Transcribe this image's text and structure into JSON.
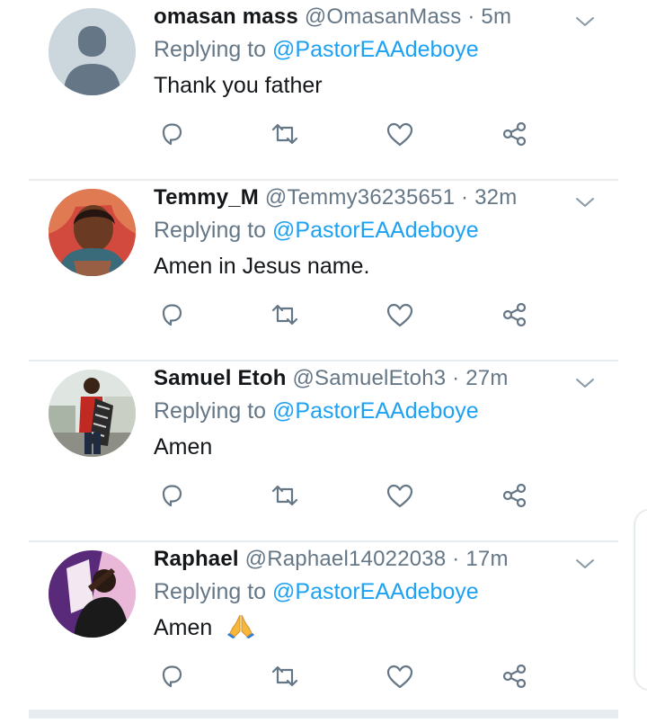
{
  "tweets": [
    {
      "display_name": "omasan mass",
      "handle": "@OmasanMass",
      "time": "5m",
      "replying_prefix": "Replying to",
      "replying_to": "@PastorEAAdeboye",
      "text": "Thank you father",
      "emoji": "",
      "avatar": "default-avatar"
    },
    {
      "display_name": "Temmy_M",
      "handle": "@Temmy36235651",
      "time": "32m",
      "replying_prefix": "Replying to",
      "replying_to": "@PastorEAAdeboye",
      "text": "Amen in Jesus name.",
      "emoji": "",
      "avatar": "photo-avatar"
    },
    {
      "display_name": "Samuel Etoh",
      "handle": "@SamuelEtoh3",
      "time": "27m",
      "replying_prefix": "Replying to",
      "replying_to": "@PastorEAAdeboye",
      "text": "Amen",
      "emoji": "",
      "avatar": "photo-avatar"
    },
    {
      "display_name": "Raphael",
      "handle": "@Raphael14022038",
      "time": "17m",
      "replying_prefix": "Replying to",
      "replying_to": "@PastorEAAdeboye",
      "text": "Amen",
      "emoji": "folded-hands-emoji",
      "avatar": "photo-avatar"
    }
  ],
  "colors": {
    "text_primary": "#14171a",
    "text_secondary": "#657786",
    "link": "#1da1f2",
    "divider": "#e6ecf0"
  },
  "icons": [
    "chevron-down-icon",
    "reply-icon",
    "retweet-icon",
    "like-icon",
    "share-icon"
  ]
}
